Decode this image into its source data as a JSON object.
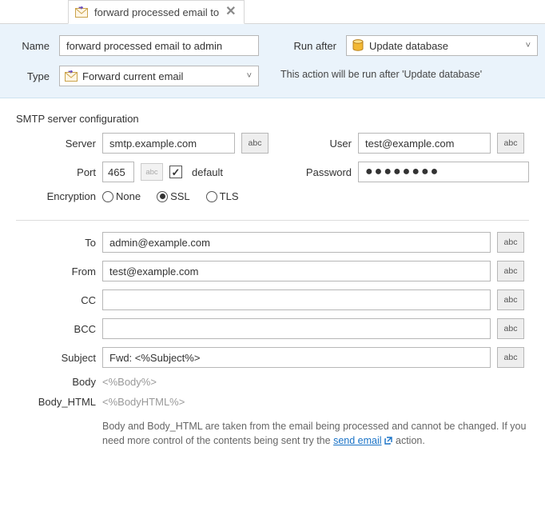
{
  "tab": {
    "title": "forward processed email to"
  },
  "header": {
    "name_label": "Name",
    "name_value": "forward processed email to admin",
    "type_label": "Type",
    "type_value": "Forward current email",
    "runafter_label": "Run after",
    "runafter_value": "Update database",
    "helper_text": "This action will be run after 'Update database'"
  },
  "smtp": {
    "title": "SMTP server configuration",
    "server_label": "Server",
    "server_value": "smtp.example.com",
    "user_label": "User",
    "user_value": "test@example.com",
    "port_label": "Port",
    "port_value": "465",
    "default_label": "default",
    "default_checked": true,
    "password_label": "Password",
    "password_value": "●●●●●●●●",
    "encryption_label": "Encryption",
    "enc_options": {
      "none": "None",
      "ssl": "SSL",
      "tls": "TLS"
    },
    "enc_selected": "ssl",
    "abc": "abc"
  },
  "email": {
    "to_label": "To",
    "to_value": "admin@example.com",
    "from_label": "From",
    "from_value": "test@example.com",
    "cc_label": "CC",
    "cc_value": "",
    "bcc_label": "BCC",
    "bcc_value": "",
    "subject_label": "Subject",
    "subject_value": "Fwd: <%Subject%>",
    "body_label": "Body",
    "body_value": "<%Body%>",
    "bodyhtml_label": "Body_HTML",
    "bodyhtml_value": "<%BodyHTML%>",
    "note_pre": "Body and Body_HTML are taken from the email being processed and cannot be changed. If you need more control of the contents being sent try the ",
    "note_link": "send email",
    "note_post": " action."
  }
}
